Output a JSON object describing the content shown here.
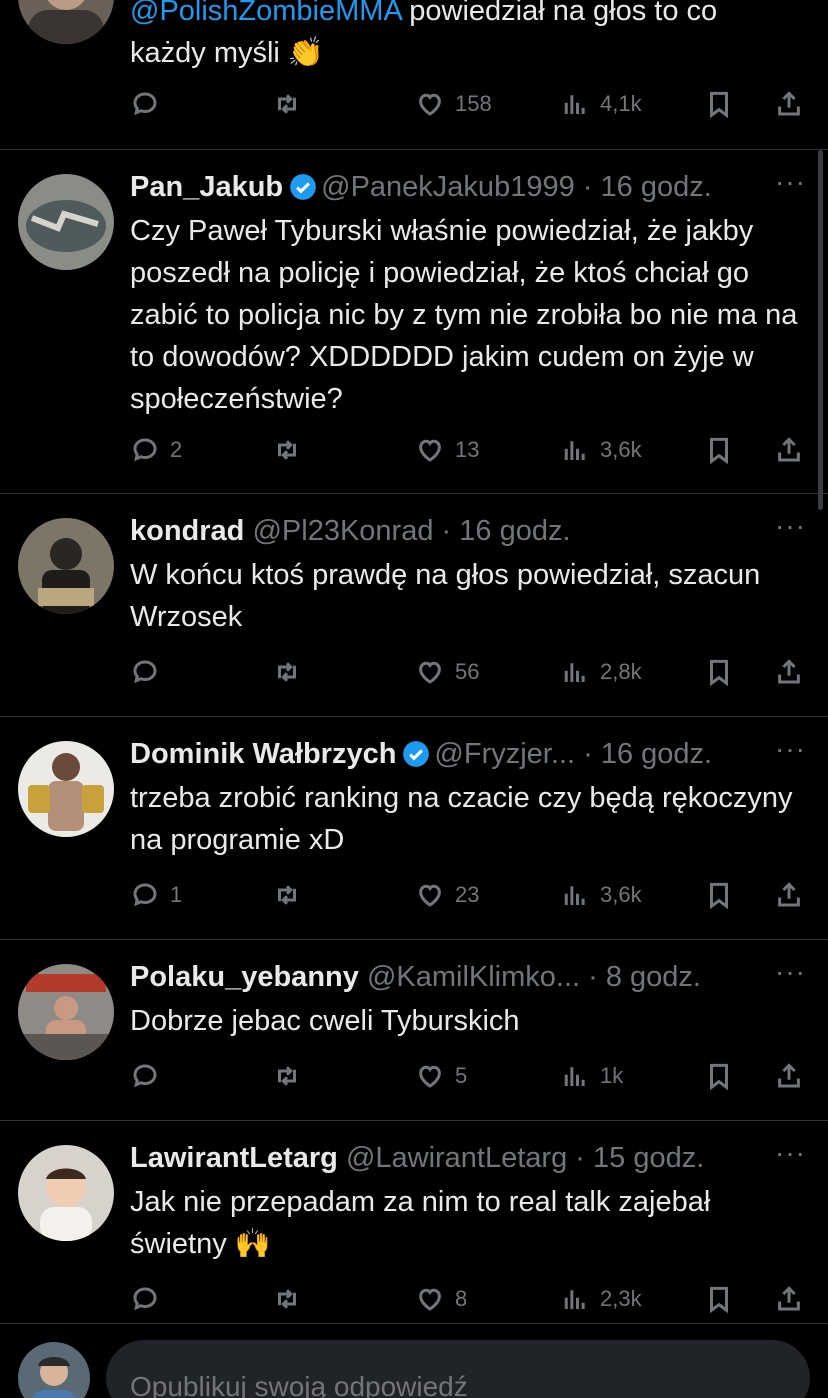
{
  "colors": {
    "background": "#000000",
    "text": "#e7e9ea",
    "secondary": "#71767b",
    "accent": "#1d9bf0",
    "divider": "#2f3336"
  },
  "first_tweet": {
    "mention": "@PolishZombieMMA",
    "text_after_mention": " powiedział na głos to co",
    "text_line2": "każdy myśli 👏",
    "reply_count": "",
    "like_count": "158",
    "view_count": "4,1k"
  },
  "tweets": [
    {
      "name": "Pan_Jakub",
      "verified": true,
      "handle": "@PanekJakub1999",
      "dot": " · ",
      "time": "16 godz.",
      "text": "Czy Paweł Tyburski właśnie powiedział, że jakby poszedł na policję i powiedział, że ktoś chciał go zabić to policja nic by z tym nie zrobiła bo nie ma na to dowodów? XDDDDDD jakim cudem on żyje w społeczeństwie?",
      "reply_count": "2",
      "like_count": "13",
      "view_count": "3,6k"
    },
    {
      "name": "kondrad",
      "verified": false,
      "handle": "@Pl23Konrad",
      "dot": " · ",
      "time": "16 godz.",
      "text": "W końcu ktoś prawdę na głos powiedział, szacun Wrzosek",
      "reply_count": "",
      "like_count": "56",
      "view_count": "2,8k"
    },
    {
      "name": "Dominik Wałbrzych",
      "verified": true,
      "handle": "@Fryzjer...",
      "dot": " · ",
      "time": "16 godz.",
      "text": "trzeba zrobić ranking na czacie czy będą rękoczyny na programie xD",
      "reply_count": "1",
      "like_count": "23",
      "view_count": "3,6k"
    },
    {
      "name": "Polaku_yebanny",
      "verified": false,
      "handle": "@KamilKlimko...",
      "dot": " · ",
      "time": "8 godz.",
      "text": "Dobrze jebac cweli  Tyburskich",
      "reply_count": "",
      "like_count": "5",
      "view_count": "1k"
    },
    {
      "name": "LawirantLetarg",
      "verified": false,
      "handle": "@LawirantLetarg",
      "dot": " · ",
      "time": "15 godz.",
      "text": "Jak nie przepadam za nim to real talk zajebał świetny 🙌",
      "reply_count": "",
      "like_count": "8",
      "view_count": "2,3k"
    }
  ],
  "more_label": "···",
  "composer": {
    "placeholder": "Opublikuj swoją odpowiedź"
  },
  "icons": {
    "reply": "reply-icon",
    "repost": "repost-icon",
    "like": "heart-icon",
    "views": "views-icon",
    "bookmark": "bookmark-icon",
    "share": "share-icon",
    "verified": "verified-badge-icon",
    "more": "more-icon"
  }
}
